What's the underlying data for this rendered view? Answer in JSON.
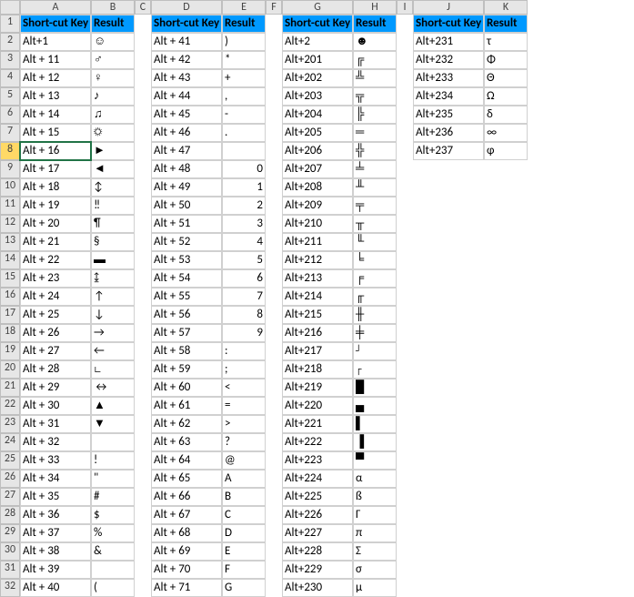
{
  "columns": [
    "A",
    "B",
    "C",
    "D",
    "E",
    "F",
    "G",
    "H",
    "I",
    "J",
    "K"
  ],
  "rowCount": 32,
  "activeCell": {
    "row": 8,
    "col": "A"
  },
  "groups": [
    {
      "keyCol": "A",
      "resCol": "B",
      "startRow": 1,
      "headerKey": "Short-cut Key",
      "headerRes": "Result",
      "rows": [
        [
          "Alt+1",
          "☺"
        ],
        [
          "Alt + 11",
          "♂"
        ],
        [
          "Alt + 12",
          "♀"
        ],
        [
          "Alt + 13",
          "♪"
        ],
        [
          "Alt + 14",
          "♫"
        ],
        [
          "Alt + 15",
          "☼"
        ],
        [
          "Alt + 16",
          "►"
        ],
        [
          "Alt + 17",
          "◄"
        ],
        [
          "Alt + 18",
          "↕"
        ],
        [
          "Alt + 19",
          "‼"
        ],
        [
          "Alt + 20",
          "¶"
        ],
        [
          "Alt + 21",
          "§"
        ],
        [
          "Alt + 22",
          "▬"
        ],
        [
          "Alt + 23",
          "↨"
        ],
        [
          "Alt + 24",
          "↑"
        ],
        [
          "Alt + 25",
          "↓"
        ],
        [
          "Alt + 26",
          "→"
        ],
        [
          "Alt + 27",
          "←"
        ],
        [
          "Alt + 28",
          "∟"
        ],
        [
          "Alt + 29",
          "↔"
        ],
        [
          "Alt + 30",
          "▲"
        ],
        [
          "Alt + 31",
          "▼"
        ],
        [
          "Alt + 32",
          ""
        ],
        [
          "Alt + 33",
          "!"
        ],
        [
          "Alt + 34",
          "\""
        ],
        [
          "Alt + 35",
          "#"
        ],
        [
          "Alt + 36",
          "$"
        ],
        [
          "Alt + 37",
          "%"
        ],
        [
          "Alt + 38",
          "&"
        ],
        [
          "Alt + 39",
          ""
        ],
        [
          "Alt + 40",
          "("
        ]
      ]
    },
    {
      "keyCol": "D",
      "resCol": "E",
      "startRow": 1,
      "headerKey": "Short-cut Key",
      "headerRes": "Result",
      "rows": [
        [
          "Alt + 41",
          ")"
        ],
        [
          "Alt + 42",
          "*"
        ],
        [
          "Alt + 43",
          "+"
        ],
        [
          "Alt + 44",
          ","
        ],
        [
          "Alt + 45",
          "-"
        ],
        [
          "Alt + 46",
          "."
        ],
        [
          "Alt + 47",
          ""
        ],
        [
          "Alt + 48",
          "0"
        ],
        [
          "Alt + 49",
          "1"
        ],
        [
          "Alt + 50",
          "2"
        ],
        [
          "Alt + 51",
          "3"
        ],
        [
          "Alt + 52",
          "4"
        ],
        [
          "Alt + 53",
          "5"
        ],
        [
          "Alt + 54",
          "6"
        ],
        [
          "Alt + 55",
          "7"
        ],
        [
          "Alt + 56",
          "8"
        ],
        [
          "Alt + 57",
          "9"
        ],
        [
          "Alt + 58",
          ":"
        ],
        [
          "Alt + 59",
          ";"
        ],
        [
          "Alt + 60",
          "<"
        ],
        [
          "Alt + 61",
          "="
        ],
        [
          "Alt + 62",
          ">"
        ],
        [
          "Alt + 63",
          "?"
        ],
        [
          "Alt + 64",
          "@"
        ],
        [
          "Alt + 65",
          "A"
        ],
        [
          "Alt + 66",
          "B"
        ],
        [
          "Alt + 67",
          "C"
        ],
        [
          "Alt + 68",
          "D"
        ],
        [
          "Alt + 69",
          "E"
        ],
        [
          "Alt + 70",
          "F"
        ],
        [
          "Alt + 71",
          "G"
        ]
      ]
    },
    {
      "keyCol": "G",
      "resCol": "H",
      "startRow": 1,
      "headerKey": "Short-cut Key",
      "headerRes": "Result",
      "rows": [
        [
          "Alt+2",
          "☻"
        ],
        [
          "Alt+201",
          "╔"
        ],
        [
          "Alt+202",
          "╩"
        ],
        [
          "Alt+203",
          "╦"
        ],
        [
          "Alt+204",
          "╠"
        ],
        [
          "Alt+205",
          "═"
        ],
        [
          "Alt+206",
          "╬"
        ],
        [
          "Alt+207",
          "╧"
        ],
        [
          "Alt+208",
          "╨"
        ],
        [
          "Alt+209",
          "╤"
        ],
        [
          "Alt+210",
          "╥"
        ],
        [
          "Alt+211",
          "╙"
        ],
        [
          "Alt+212",
          "╘"
        ],
        [
          "Alt+213",
          "╒"
        ],
        [
          "Alt+214",
          "╓"
        ],
        [
          "Alt+215",
          "╫"
        ],
        [
          "Alt+216",
          "╪"
        ],
        [
          "Alt+217",
          "┘"
        ],
        [
          "Alt+218",
          "┌"
        ],
        [
          "Alt+219",
          "█"
        ],
        [
          "Alt+220",
          "▄"
        ],
        [
          "Alt+221",
          "▌"
        ],
        [
          "Alt+222",
          "▐"
        ],
        [
          "Alt+223",
          "▀"
        ],
        [
          "Alt+224",
          "α"
        ],
        [
          "Alt+225",
          "ß"
        ],
        [
          "Alt+226",
          "Γ"
        ],
        [
          "Alt+227",
          "π"
        ],
        [
          "Alt+228",
          "Σ"
        ],
        [
          "Alt+229",
          "σ"
        ],
        [
          "Alt+230",
          "µ"
        ]
      ]
    },
    {
      "keyCol": "J",
      "resCol": "K",
      "startRow": 1,
      "headerKey": "Short-cut Key",
      "headerRes": "Result",
      "rows": [
        [
          "Alt+231",
          "τ"
        ],
        [
          "Alt+232",
          "Φ"
        ],
        [
          "Alt+233",
          "Θ"
        ],
        [
          "Alt+234",
          "Ω"
        ],
        [
          "Alt+235",
          "δ"
        ],
        [
          "Alt+236",
          "∞"
        ],
        [
          "Alt+237",
          "φ"
        ]
      ]
    }
  ]
}
